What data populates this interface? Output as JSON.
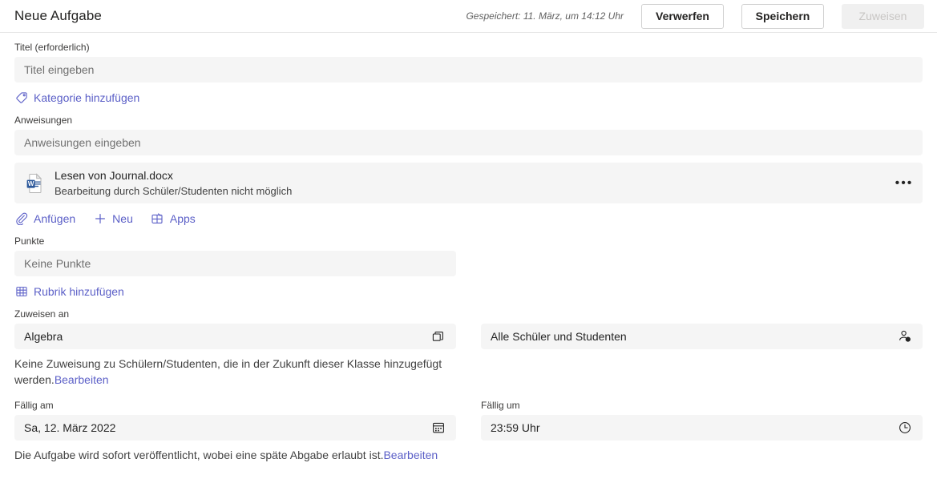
{
  "header": {
    "title": "Neue Aufgabe",
    "saved_status": "Gespeichert: 11. März, um 14:12 Uhr",
    "discard_label": "Verwerfen",
    "save_label": "Speichern",
    "assign_label": "Zuweisen"
  },
  "title_field": {
    "label": "Titel (erforderlich)",
    "placeholder": "Titel eingeben",
    "value": ""
  },
  "category_link": {
    "label": "Kategorie hinzufügen",
    "icon": "tag-icon"
  },
  "instructions_field": {
    "label": "Anweisungen",
    "placeholder": "Anweisungen eingeben",
    "value": ""
  },
  "attachment": {
    "icon": "word-document-icon",
    "title": "Lesen von Journal.docx",
    "subtitle": "Bearbeitung durch Schüler/Studenten nicht möglich",
    "more_label": "•••",
    "more_icon": "more-options-icon"
  },
  "attachment_actions": [
    {
      "label": "Anfügen",
      "icon": "paperclip-icon"
    },
    {
      "label": "Neu",
      "icon": "plus-icon"
    },
    {
      "label": "Apps",
      "icon": "apps-grid-icon"
    }
  ],
  "points_field": {
    "label": "Punkte",
    "placeholder": "Keine Punkte",
    "value": ""
  },
  "rubric_link": {
    "label": "Rubrik hinzufügen",
    "icon": "rubric-grid-icon"
  },
  "assign_section": {
    "label": "Zuweisen an",
    "class_value": "Algebra",
    "class_icon": "multiple-classes-icon",
    "students_value": "Alle Schüler und Studenten",
    "students_icon": "person-add-icon",
    "helper_text": "Keine Zuweisung zu Schülern/Studenten, die in der Zukunft dieser Klasse hinzugefügt werden.",
    "helper_link": "Bearbeiten"
  },
  "due_date": {
    "label": "Fällig am",
    "value": "Sa, 12. März 2022",
    "icon": "calendar-icon"
  },
  "due_time": {
    "label": "Fällig um",
    "value": "23:59 Uhr",
    "icon": "clock-icon"
  },
  "publish_note": {
    "text": "Die Aufgabe wird sofort veröffentlicht, wobei eine späte Abgabe erlaubt ist.",
    "link": "Bearbeiten"
  },
  "colors": {
    "accent": "#5b5fc7",
    "field_bg": "#f5f5f5",
    "text": "#242424",
    "muted": "#707070",
    "word_blue": "#2b579a"
  }
}
